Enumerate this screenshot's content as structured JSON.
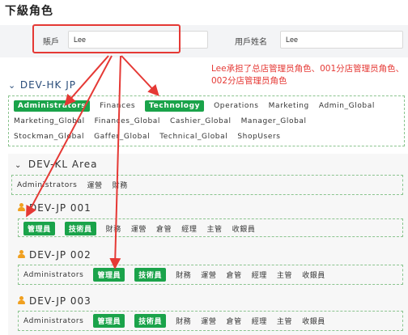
{
  "page_title": "下級角色",
  "filter": {
    "account_label": "賬戶",
    "account_value": "Lee",
    "username_label": "用戶姓名",
    "username_value": "Lee"
  },
  "annotation": "Lee承担了总店管理员角色、001分店管理员角色、002分店管理员角色",
  "root": {
    "name": "DEV-HK JP",
    "roles_line1": [
      {
        "label": "Administrators",
        "selected": true
      },
      {
        "label": "Finances",
        "selected": false
      },
      {
        "label": "Technology",
        "selected": true
      },
      {
        "label": "Operations",
        "selected": false
      },
      {
        "label": "Marketing",
        "selected": false
      },
      {
        "label": "Admin_Global",
        "selected": false
      }
    ],
    "roles_line2": [
      {
        "label": "Marketing_Global",
        "selected": false
      },
      {
        "label": "Finances_Global",
        "selected": false
      },
      {
        "label": "Cashier_Global",
        "selected": false
      },
      {
        "label": "Manager_Global",
        "selected": false
      }
    ],
    "roles_line3": [
      {
        "label": "Stockman_Global",
        "selected": false
      },
      {
        "label": "Gaffer_Global",
        "selected": false
      },
      {
        "label": "Technical_Global",
        "selected": false
      },
      {
        "label": "ShopUsers",
        "selected": false
      }
    ]
  },
  "area": {
    "name": "DEV-KL Area",
    "roles": [
      {
        "label": "Administrators",
        "selected": false
      },
      {
        "label": "運營",
        "selected": false
      },
      {
        "label": "財務",
        "selected": false
      }
    ]
  },
  "branches": [
    {
      "name": "DEV-JP 001",
      "roles": [
        {
          "label": "管理員",
          "selected": true
        },
        {
          "label": "技術員",
          "selected": true
        },
        {
          "label": "財務",
          "selected": false
        },
        {
          "label": "運營",
          "selected": false
        },
        {
          "label": "倉管",
          "selected": false
        },
        {
          "label": "經理",
          "selected": false
        },
        {
          "label": "主管",
          "selected": false
        },
        {
          "label": "收銀員",
          "selected": false
        }
      ]
    },
    {
      "name": "DEV-JP 002",
      "roles": [
        {
          "label": "Administrators",
          "selected": false
        },
        {
          "label": "管理員",
          "selected": true
        },
        {
          "label": "技術員",
          "selected": true
        },
        {
          "label": "財務",
          "selected": false
        },
        {
          "label": "運營",
          "selected": false
        },
        {
          "label": "倉管",
          "selected": false
        },
        {
          "label": "經理",
          "selected": false
        },
        {
          "label": "主管",
          "selected": false
        },
        {
          "label": "收銀員",
          "selected": false
        }
      ]
    },
    {
      "name": "DEV-JP 003",
      "roles": [
        {
          "label": "Administrators",
          "selected": false
        },
        {
          "label": "管理員",
          "selected": true
        },
        {
          "label": "技術員",
          "selected": true
        },
        {
          "label": "財務",
          "selected": false
        },
        {
          "label": "運營",
          "selected": false
        },
        {
          "label": "倉管",
          "selected": false
        },
        {
          "label": "經理",
          "selected": false
        },
        {
          "label": "主管",
          "selected": false
        },
        {
          "label": "收銀員",
          "selected": false
        }
      ]
    }
  ],
  "colors": {
    "selected_bg": "#1aa34a",
    "annotation": "#e53935",
    "dashed_border": "#8bc48f",
    "person_icon": "#f0a020"
  }
}
